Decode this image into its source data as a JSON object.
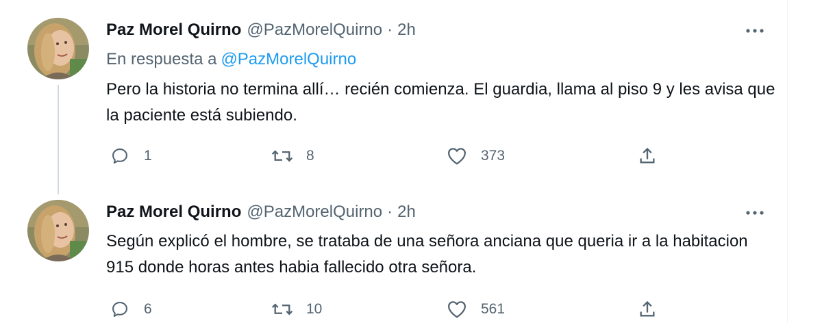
{
  "tweets": [
    {
      "author_name": "Paz Morel Quirno",
      "handle": "@PazMorelQuirno",
      "separator": "·",
      "time": "2h",
      "reply_prefix": "En respuesta a",
      "reply_mention": "@PazMorelQuirno",
      "text": "Pero la historia no termina allí… recién comienza. El guardia, llama al piso 9 y les avisa que la paciente está subiendo.",
      "replies": "1",
      "retweets": "8",
      "likes": "373",
      "icons": [
        "more-icon",
        "reply-icon",
        "retweet-icon",
        "like-icon",
        "share-icon"
      ]
    },
    {
      "author_name": "Paz Morel Quirno",
      "handle": "@PazMorelQuirno",
      "separator": "·",
      "time": "2h",
      "text": "Según explicó el hombre, se trataba de una señora anciana que queria ir a la habitacion 915 donde horas antes habia fallecido otra señora.",
      "replies": "6",
      "retweets": "10",
      "likes": "561",
      "icons": [
        "more-icon",
        "reply-icon",
        "retweet-icon",
        "like-icon",
        "share-icon"
      ]
    }
  ],
  "colors": {
    "text": "#0f1419",
    "secondary": "#536471",
    "link": "#1d9bf0",
    "thread_line": "#cfd9de"
  }
}
